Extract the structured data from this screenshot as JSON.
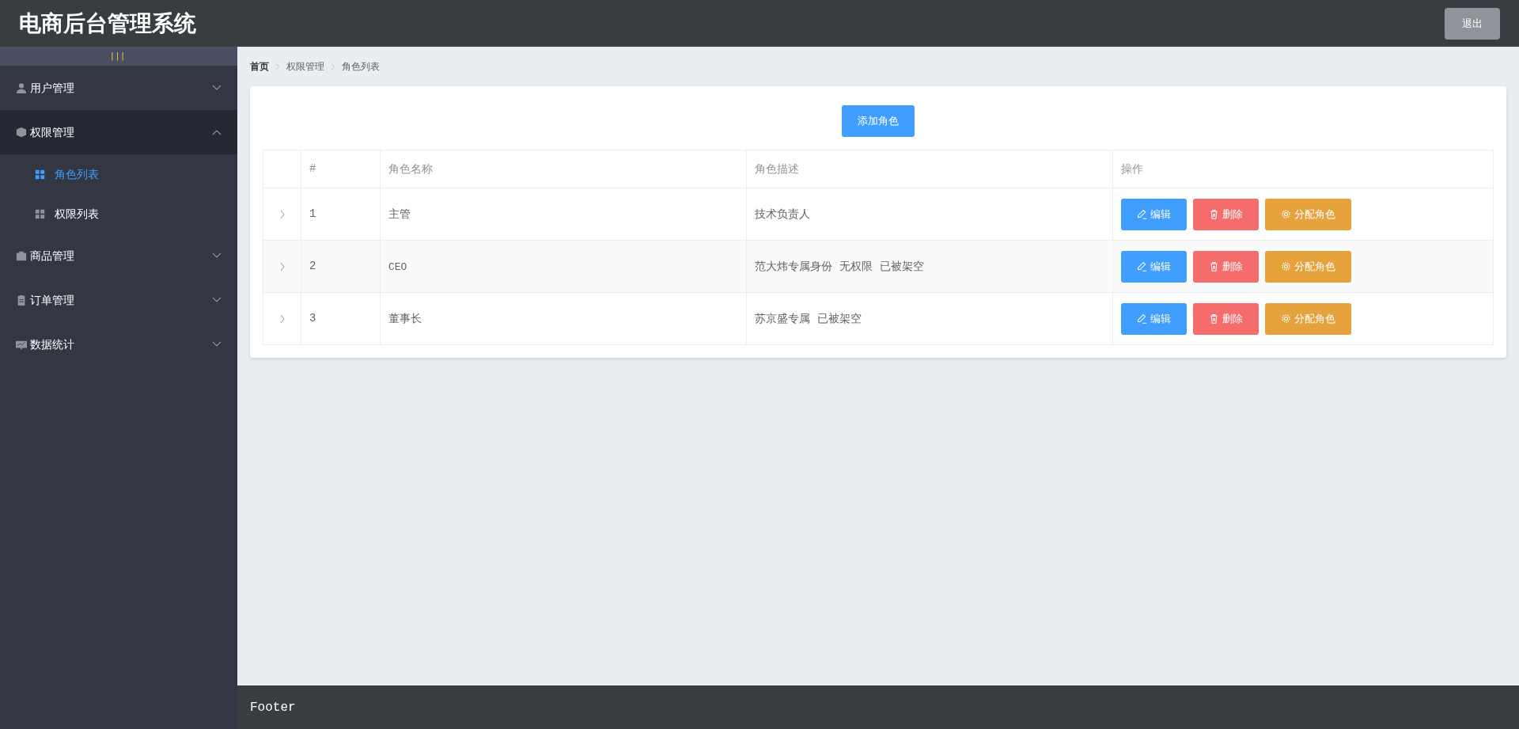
{
  "header": {
    "title": "电商后台管理系统",
    "logout": "退出"
  },
  "sidebar": {
    "toggle": "|||",
    "menus": [
      {
        "label": "用户管理",
        "expanded": false
      },
      {
        "label": "权限管理",
        "expanded": true,
        "children": [
          {
            "label": "角色列表",
            "selected": true
          },
          {
            "label": "权限列表",
            "selected": false
          }
        ]
      },
      {
        "label": "商品管理",
        "expanded": false
      },
      {
        "label": "订单管理",
        "expanded": false
      },
      {
        "label": "数据统计",
        "expanded": false
      }
    ]
  },
  "breadcrumb": [
    "首页",
    "权限管理",
    "角色列表"
  ],
  "add_button": "添加角色",
  "table": {
    "columns": [
      "#",
      "角色名称",
      "角色描述",
      "操作"
    ],
    "rows": [
      {
        "expanded": false,
        "index": "1",
        "name": "主管",
        "description": "技术负责人",
        "actions": [
          {
            "kind": "edit",
            "label": "编辑"
          },
          {
            "kind": "delete",
            "label": "删除"
          },
          {
            "kind": "assign",
            "label": "分配角色"
          }
        ]
      },
      {
        "expanded": false,
        "index": "2",
        "name": "CEO",
        "description": "范大炜专属身份  无权限  已被架空",
        "actions": [
          {
            "kind": "edit",
            "label": "编辑"
          },
          {
            "kind": "delete",
            "label": "删除"
          },
          {
            "kind": "assign",
            "label": "分配角色"
          }
        ]
      },
      {
        "expanded": false,
        "index": "3",
        "name": "董事长",
        "description": "苏京盛专属  已被架空",
        "actions": [
          {
            "kind": "edit",
            "label": "编辑"
          },
          {
            "kind": "delete",
            "label": "删除"
          },
          {
            "kind": "assign",
            "label": "分配角色"
          }
        ]
      }
    ]
  },
  "footer": "Footer"
}
